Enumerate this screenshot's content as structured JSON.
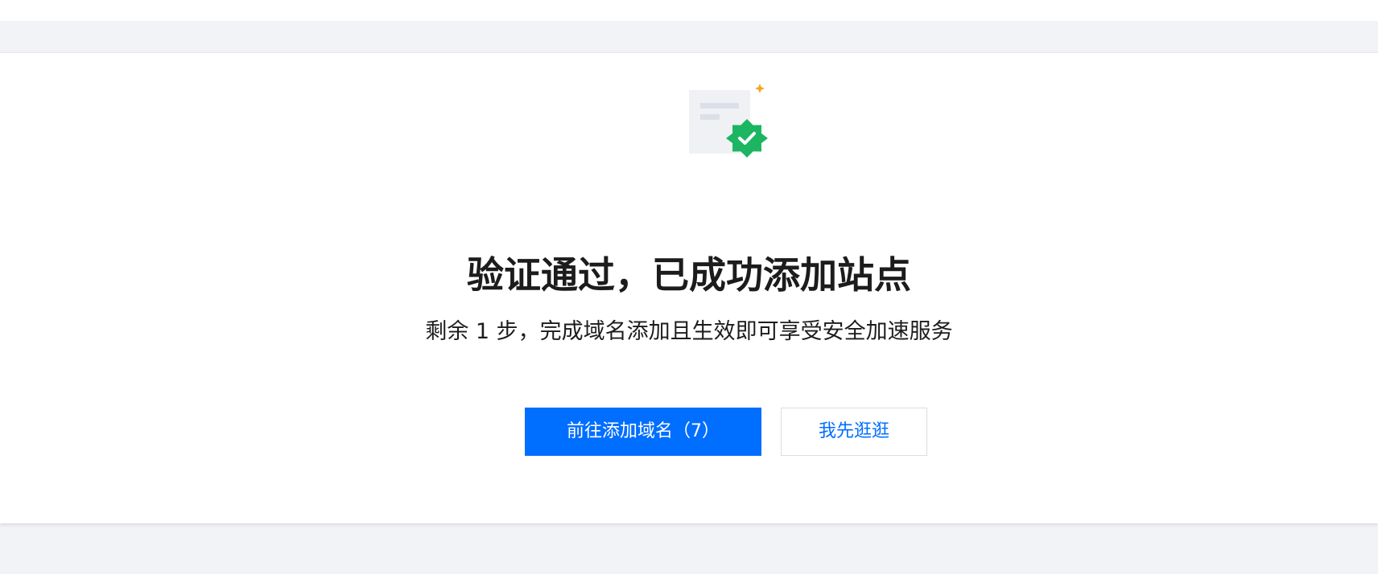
{
  "success_card": {
    "title": "验证通过，已成功添加站点",
    "subtitle": "剩余 1 步，完成域名添加且生效即可享受安全加速服务",
    "primary_button_label": "前往添加域名（7）",
    "secondary_button_label": "我先逛逛",
    "illustration": {
      "icons": [
        "document-icon",
        "verified-badge-icon",
        "sparkle-icon"
      ]
    }
  },
  "colors": {
    "primary": "#006eff",
    "badge_green": "#1cb562",
    "sparkle_orange": "#f5a623",
    "page_background": "#f2f3f7",
    "card_background": "#ffffff",
    "text": "#1c1c1c"
  }
}
